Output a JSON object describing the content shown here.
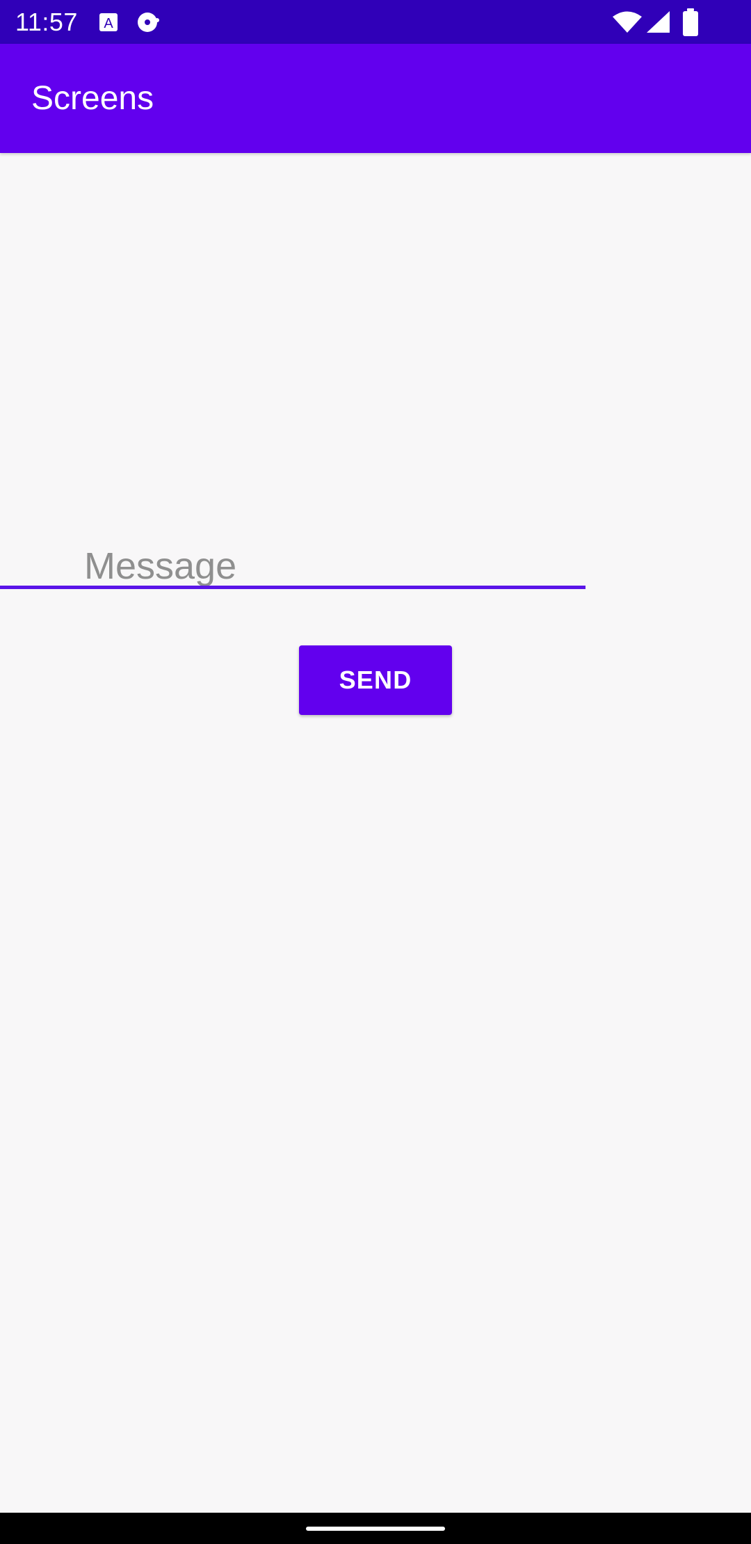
{
  "status_bar": {
    "time": "11:57",
    "left_icons": [
      "text-a-icon",
      "media-disc-icon"
    ],
    "right_icons": [
      "wifi-icon",
      "cellular-signal-icon",
      "battery-icon"
    ],
    "color": "#3000b8"
  },
  "app_bar": {
    "title": "Screens",
    "color": "#6200ee"
  },
  "form": {
    "message_placeholder": "Message",
    "message_value": "",
    "send_label": "SEND",
    "accent_color": "#6200ee"
  },
  "nav_bar": {
    "icons": [
      "home-handle-icon"
    ]
  }
}
